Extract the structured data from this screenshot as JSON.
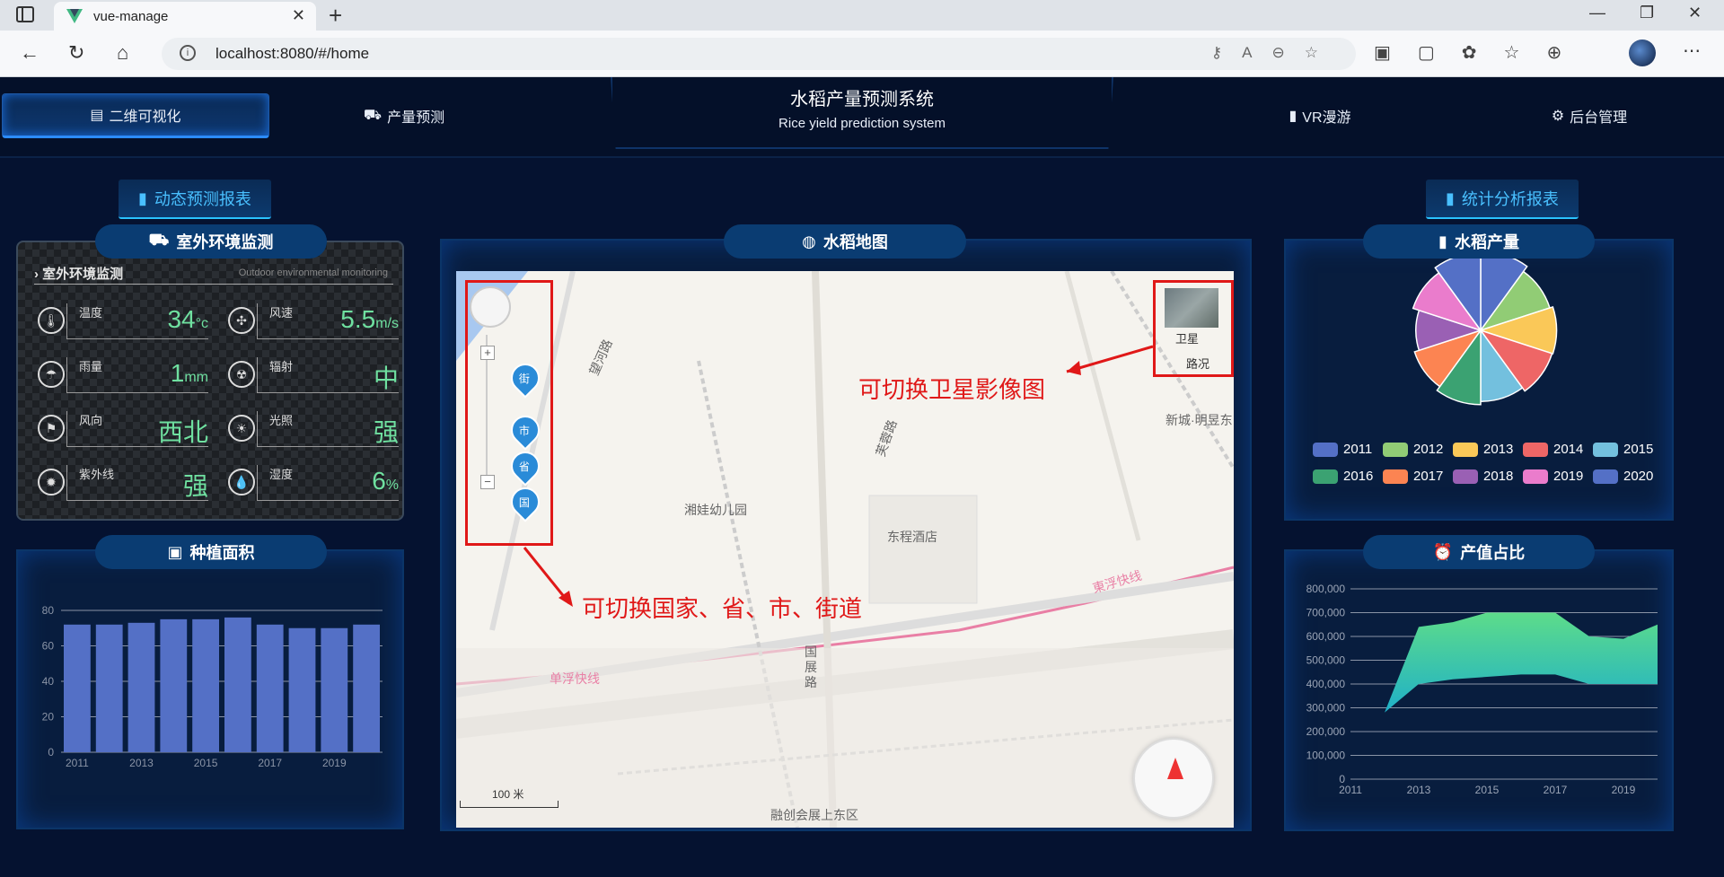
{
  "browser": {
    "tab_title": "vue-manage",
    "url": "localhost:8080/#/home"
  },
  "nav": {
    "items": [
      {
        "label": "二维可视化",
        "active": true
      },
      {
        "label": "产量预测",
        "active": false
      },
      {
        "label": "VR漫游",
        "active": false
      },
      {
        "label": "后台管理",
        "active": false
      }
    ],
    "title_zh": "水稻产量预测系统",
    "title_en": "Rice yield prediction system"
  },
  "buttons": {
    "dynamic_report": "动态预测报表",
    "stat_report": "统计分析报表"
  },
  "env_panel": {
    "title": "室外环境监测",
    "sub_zh": "室外环境监测",
    "sub_en": "Outdoor environmental monitoring",
    "cells": [
      {
        "label": "温度",
        "value": "34",
        "unit": "°c",
        "icon": "thermometer-icon"
      },
      {
        "label": "风速",
        "value": "5.5",
        "unit": "m/s",
        "icon": "fan-icon"
      },
      {
        "label": "雨量",
        "value": "1",
        "unit": "mm",
        "icon": "rain-icon"
      },
      {
        "label": "辐射",
        "value": "中",
        "unit": "",
        "icon": "radiation-icon"
      },
      {
        "label": "风向",
        "value": "西北",
        "unit": "",
        "icon": "wind-direction-icon"
      },
      {
        "label": "光照",
        "value": "强",
        "unit": "",
        "icon": "sun-icon"
      },
      {
        "label": "紫外线",
        "value": "强",
        "unit": "",
        "icon": "uv-icon"
      },
      {
        "label": "湿度",
        "value": "6",
        "unit": "%",
        "icon": "humidity-icon"
      }
    ]
  },
  "map_panel": {
    "title": "水稻地图",
    "satellite_label": "卫星",
    "road_label": "路况",
    "annotation_sat": "可切换卫星影像图",
    "annotation_zoom": "可切换国家、省、市、街道",
    "zoom_levels": [
      "街",
      "市",
      "省",
      "国"
    ],
    "scale": "100 米",
    "places": [
      "湘娃幼儿园",
      "东程酒店",
      "新城·明昱东",
      "融创会展上东区",
      "国展路",
      "望河路",
      "芙蓉路",
      "東浮快线",
      "单浮快线"
    ]
  },
  "yield_panel": {
    "title": "水稻产量",
    "legend": [
      "2011",
      "2012",
      "2013",
      "2014",
      "2015",
      "2016",
      "2017",
      "2018",
      "2019",
      "2020"
    ],
    "colors": [
      "#5470c6",
      "#91cc75",
      "#fac858",
      "#ee6666",
      "#73c0de",
      "#3ba272",
      "#fc8452",
      "#9a60b4",
      "#ea7ccc",
      "#5470c6"
    ]
  },
  "area_panel": {
    "title": "种植面积"
  },
  "value_panel": {
    "title": "产值占比"
  },
  "chart_data": [
    {
      "type": "bar",
      "title": "种植面积",
      "categories": [
        "2011",
        "2012",
        "2013",
        "2014",
        "2015",
        "2016",
        "2017",
        "2018",
        "2019",
        "2020"
      ],
      "x_tick_labels": [
        "2011",
        "2013",
        "2015",
        "2017",
        "2019"
      ],
      "values": [
        72,
        72,
        73,
        75,
        75,
        76,
        72,
        70,
        70,
        72
      ],
      "ylim": [
        0,
        80
      ],
      "yticks": [
        0,
        20,
        40,
        60,
        80
      ],
      "color": "#5470c6"
    },
    {
      "type": "pie",
      "title": "水稻产量",
      "rose": true,
      "labels": [
        "2011",
        "2012",
        "2013",
        "2014",
        "2015",
        "2016",
        "2017",
        "2018",
        "2019",
        "2020"
      ],
      "values": [
        100,
        92,
        96,
        95,
        90,
        94,
        88,
        82,
        90,
        98
      ]
    },
    {
      "type": "area",
      "title": "产值占比",
      "x": [
        "2011",
        "2012",
        "2013",
        "2014",
        "2015",
        "2016",
        "2017",
        "2018",
        "2019",
        "2020"
      ],
      "x_tick_labels": [
        "2011",
        "2013",
        "2015",
        "2017",
        "2019"
      ],
      "upper": [
        560000,
        280000,
        640000,
        660000,
        700000,
        700000,
        700000,
        600000,
        590000,
        650000
      ],
      "lower": [
        560000,
        280000,
        400000,
        420000,
        430000,
        440000,
        440000,
        400000,
        400000,
        400000
      ],
      "ylim": [
        0,
        800000
      ],
      "yticks": [
        "0",
        "100,000",
        "200,000",
        "300,000",
        "400,000",
        "500,000",
        "600,000",
        "700,000",
        "800,000"
      ]
    }
  ]
}
